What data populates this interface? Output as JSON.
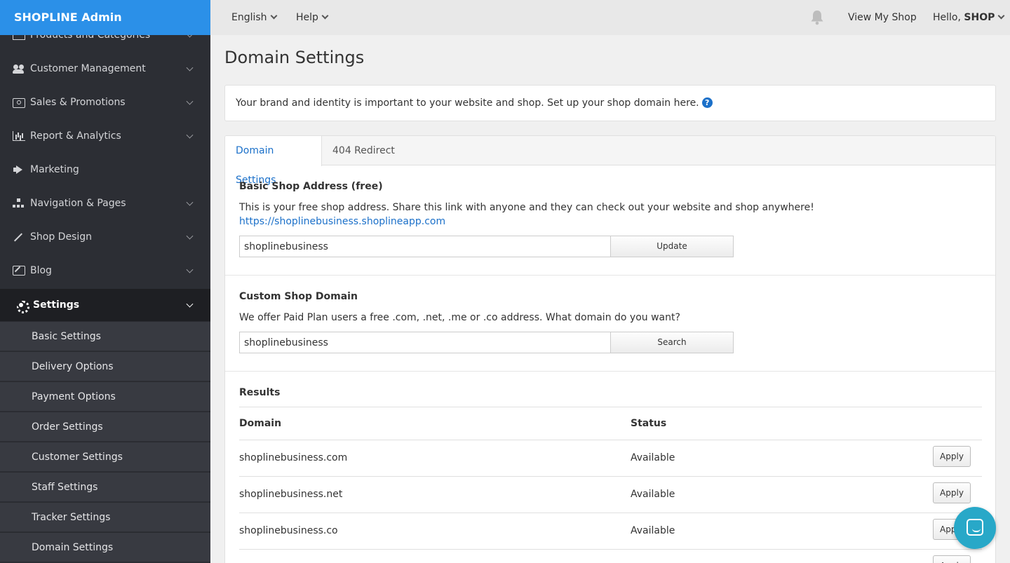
{
  "brand": "SHOPLINE Admin",
  "topbar": {
    "language": "English",
    "help": "Help",
    "view_shop": "View My Shop",
    "hello_prefix": "Hello, ",
    "user": "SHOP"
  },
  "sidebar": {
    "items": [
      {
        "label": "Products and Categories",
        "icon": "box-icon"
      },
      {
        "label": "Customer Management",
        "icon": "users-icon"
      },
      {
        "label": "Sales & Promotions",
        "icon": "money-icon"
      },
      {
        "label": "Report & Analytics",
        "icon": "bar-chart-icon"
      },
      {
        "label": "Marketing",
        "icon": "bullhorn-icon"
      },
      {
        "label": "Navigation & Pages",
        "icon": "sitemap-icon"
      },
      {
        "label": "Shop Design",
        "icon": "magic-wand-icon"
      },
      {
        "label": "Blog",
        "icon": "edit-icon"
      },
      {
        "label": "Settings",
        "icon": "gear-icon"
      }
    ],
    "sub_items": [
      "Basic Settings",
      "Delivery Options",
      "Payment Options",
      "Order Settings",
      "Customer Settings",
      "Staff Settings",
      "Tracker Settings",
      "Domain Settings"
    ]
  },
  "page": {
    "title": "Domain Settings",
    "intro": "Your brand and identity is important to your website and shop. Set up your shop domain here.",
    "help_glyph": "?"
  },
  "tabs": [
    "Domain Settings",
    "404 Redirect"
  ],
  "basic": {
    "title": "Basic Shop Address (free)",
    "description": "This is your free shop address. Share this link with anyone and they can check out your website and shop anywhere!",
    "link": "https://shoplinebusiness.shoplineapp.com",
    "input_value": "shoplinebusiness",
    "button": "Update"
  },
  "custom": {
    "title": "Custom Shop Domain",
    "description": "We offer Paid Plan users a free .com, .net, .me or .co address. What domain do you want?",
    "input_value": "shoplinebusiness",
    "button": "Search"
  },
  "results": {
    "title": "Results",
    "columns": [
      "Domain",
      "Status"
    ],
    "rows": [
      {
        "domain": "shoplinebusiness.com",
        "status": "Available",
        "action": "Apply"
      },
      {
        "domain": "shoplinebusiness.net",
        "status": "Available",
        "action": "Apply"
      },
      {
        "domain": "shoplinebusiness.co",
        "status": "Available",
        "action": "Apply"
      },
      {
        "domain": "",
        "status": "",
        "action": "Apply"
      }
    ]
  },
  "colors": {
    "brand_blue": "#2b90e8",
    "sidebar_bg": "#2c2e34",
    "link_blue": "#1b70c9",
    "chat_teal": "#28a8c8"
  }
}
